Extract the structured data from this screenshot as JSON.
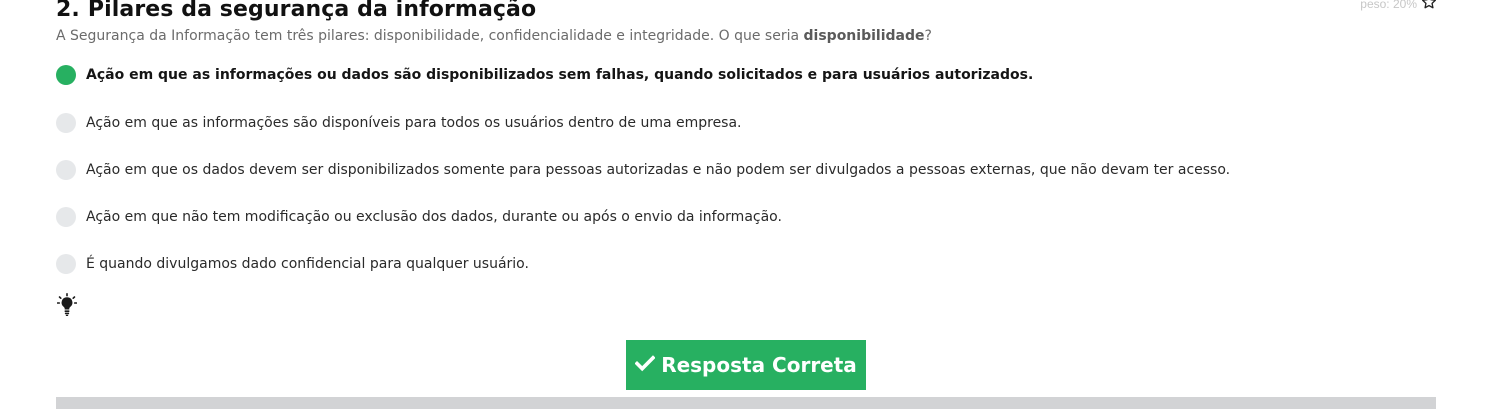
{
  "question": {
    "number": "2.",
    "title": "Pilares da segurança da informação",
    "weight": "peso: 20%",
    "text_prefix": "A Segurança da Informação tem três pilares: disponibilidade, confidencialidade e integridade. O que seria ",
    "text_emphasis": "disponibilidade",
    "text_suffix": "?"
  },
  "options": [
    {
      "label": "Ação em que as informações ou dados são disponibilizados sem falhas, quando solicitados e para usuários autorizados.",
      "selected": true
    },
    {
      "label": "Ação em que as informações são disponíveis para todos os usuários dentro de uma empresa.",
      "selected": false
    },
    {
      "label": "Ação em que os dados devem ser disponibilizados somente para pessoas autorizadas e não podem ser divulgados a pessoas externas, que não devam ter acesso.",
      "selected": false
    },
    {
      "label": "Ação em que não tem modificação ou exclusão dos dados, durante ou após o envio da informação.",
      "selected": false
    },
    {
      "label": "É quando divulgamos dado confidencial para qualquer usuário.",
      "selected": false
    }
  ],
  "result": {
    "label": "Resposta Correta",
    "icon": "check-icon"
  },
  "icons": {
    "hint": "lightbulb-icon",
    "favorite": "star-outline-icon"
  },
  "colors": {
    "accent": "#27b061",
    "radio_unchecked": "#e6e8ea",
    "divider": "#d2d3d5"
  }
}
